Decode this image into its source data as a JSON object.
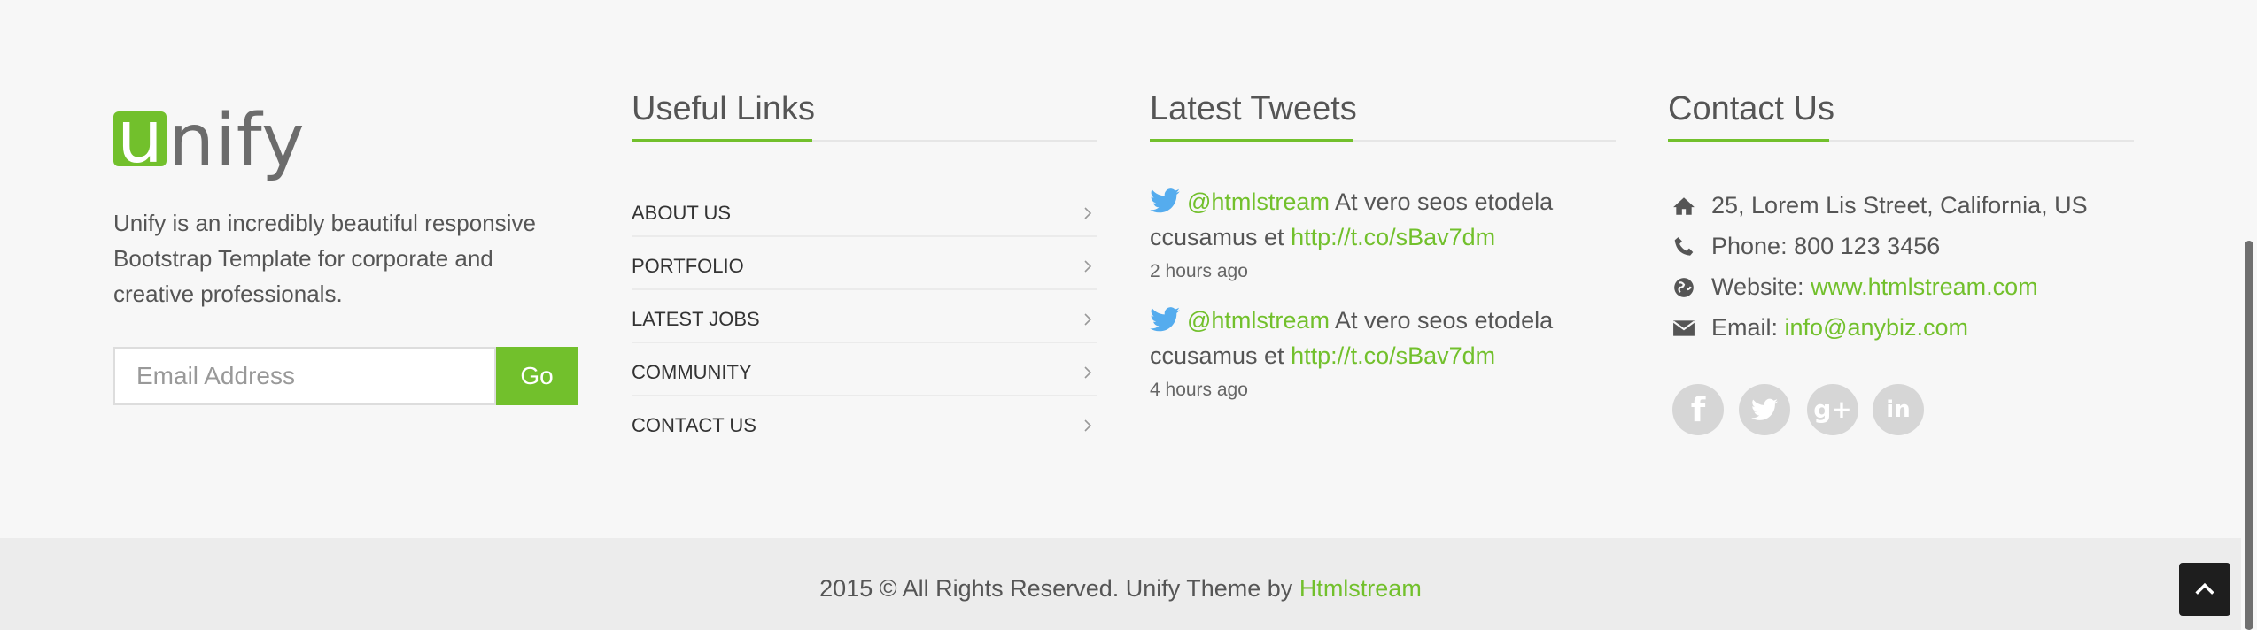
{
  "logo": {
    "mark": "u",
    "rest": "nify"
  },
  "about": {
    "text": "Unify is an incredibly beautiful responsive Bootstrap Template for corporate and creative professionals."
  },
  "newsletter": {
    "placeholder": "Email Address",
    "button_label": "Go"
  },
  "useful_links": {
    "heading": "Useful Links",
    "items": [
      {
        "label": "ABOUT US"
      },
      {
        "label": "PORTFOLIO"
      },
      {
        "label": "LATEST JOBS"
      },
      {
        "label": "COMMUNITY"
      },
      {
        "label": "CONTACT US"
      }
    ]
  },
  "tweets": {
    "heading": "Latest Tweets",
    "items": [
      {
        "handle": "@htmlstream",
        "text": " At vero seos etodela ccusamus et ",
        "link": "http://t.co/sBav7dm",
        "time": "2 hours ago"
      },
      {
        "handle": "@htmlstream",
        "text": " At vero seos etodela ccusamus et ",
        "link": "http://t.co/sBav7dm",
        "time": "4 hours ago"
      }
    ]
  },
  "contact": {
    "heading": "Contact Us",
    "address": "25, Lorem Lis Street, California, US",
    "phone": "Phone: 800 123 3456",
    "website_label": "Website: ",
    "website": "www.htmlstream.com",
    "email_label": "Email: ",
    "email": "info@anybiz.com"
  },
  "social": [
    {
      "icon": "facebook-icon",
      "glyph": "f"
    },
    {
      "icon": "twitter-icon",
      "glyph": "t"
    },
    {
      "icon": "google-plus-icon",
      "glyph": "g+"
    },
    {
      "icon": "linkedin-icon",
      "glyph": "in"
    }
  ],
  "copyright": {
    "text": "2015 © All Rights Reserved. Unify Theme by ",
    "link": "Htmlstream"
  },
  "colors": {
    "accent": "#72c02c",
    "background": "#f7f7f7",
    "text": "#555555",
    "icon_gray": "#d6d6d6"
  }
}
